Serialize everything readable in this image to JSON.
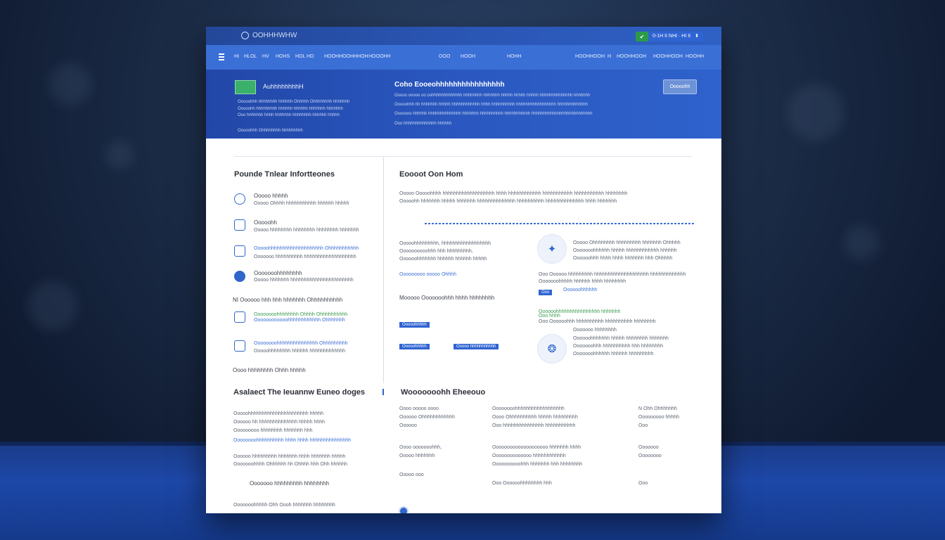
{
  "browser": {
    "brand": "OOHHHWHW",
    "account_text": "0-1H II NHI · HI II",
    "account_caret": "⬍"
  },
  "nav": {
    "items": [
      "HI",
      "HLOL",
      "HV",
      "HOHS",
      "HOL",
      "HO",
      "HOOHHOOHHHOH",
      "HOOOHH",
      "OOO",
      "HOOH",
      "HOHH",
      "HOOHHOOH",
      "H",
      "HOOHHOOH",
      "HOOHHOOH",
      "HOOHH"
    ]
  },
  "hero": {
    "badge_title": "AuhhhhhhhhH",
    "left_lines": [
      "Ooooohhh hhhhhhhh hhhhhh Ohhhhh Ohhhhhhhh hhhhhhh",
      "Ooooohh hhhhhhhhh hhhhhh hhhhhh hhhhhhh hhhhhhh",
      "Ooo hhhhhhh hhhh hhhhhhh hhhhhhhh hhhhhh hhhhh"
    ],
    "left_footer": "Ooooohhh   Ohhhhhhhh hhhhhhhhh",
    "title": "Coho Eooeohhhhhhhhhhhhhhhh",
    "desc_lines": [
      "Ooooo ooooo oo oohhhhhhhhhhhhh hhhhhhhh hhhhhhh hhhhh hhhhh hhhhh hhhhhhhhhhhhhh hhhhhhh",
      "Ooooohhh hh hhhhhhh hhhhh hhhhhhhhhhhh hhhh hhhhhhhhhh hhhhhhhhhhhhhhhhh hhhhhhhhhhhhh",
      "Ooooooo hhhhhh hhhhhhhhhhhhhh hhhhhhh hhhhhhhhhh hhhhhhhhhhh hhhhhhhhhhhhhhhhhhhhhhhhhh",
      "Ooo hhhhhhhhhhhhhh hhhhhh"
    ],
    "button": "Ooooohh"
  },
  "left_col": {
    "title": "Pounde Tnlear Infortteones",
    "items": [
      {
        "title": "Ooooo hhhhh",
        "desc": "Ooooo Ohhhh hhhhhhhhhhh hhhhhh hhhhh"
      },
      {
        "title": "Ooooohh",
        "desc": "Ooooo hhhhhhhh hhhhhhhh hhhhhhhh hhhhhhh"
      },
      {
        "title": "Ooooohhhhhhhhhhhhhhhhhhhh Ohhhhhhhhhhh",
        "desc": "Ooooooo hhhhhhhhhh hhhhhhhhhhhhhhhhhhh"
      },
      {
        "title": "Ooooooohhhhhhhh",
        "desc": "Ooooo hhhhhhh hhhhhhhhhhhhhhhhhhhhhhh"
      }
    ],
    "subheading": "NI Oooooo hhh hhh hhhhhhh Ohhhhhhhhhh",
    "sub_items": [
      {
        "title": "Oooooooohhhhhhhh Ohhhh Ohhhhhhhhhh",
        "desc": "Oooooooooooohhhhhhhhhhhh Ohhhhhhh"
      },
      {
        "title": "Oooooooohhhhhhhhhhhhhhh Ohhhhhhhhh",
        "desc": "Ooooohhhhhhhh hhhhhh hhhhhhhhhhhhh"
      }
    ],
    "footer": "Oooo hhhhhhhh Ohhh hhhhh"
  },
  "right_col": {
    "title": "Eoooot Oon Hom",
    "intro_lines": [
      "Ooooo Ooooohhhh hhhhhhhhhhhhhhhhhhh hhhh hhhhhhhhhhhh hhhhhhhhhhh hhhhhhhhhhh hhhhhhhh",
      "Ooooohh hhhhhhh hhhhh hhhhhhh hhhhhhhhhhhhhh hhhhhhhhhh hhhhhhhhhhhhhh hhhh hhhhhhh"
    ],
    "block_a": [
      "Ooooohhhhhhhhh, hhhhhhhhhhhhhhhhhh",
      "Oooooooooohhh hhh hhhhhhhhh,",
      "Oooooohhhhhhh hhhhhh hhhhhh hhhhh"
    ],
    "block_a_footer": "Ooooooooo ooooo Ohhhh",
    "block_b_title": "Mooooo Ooooooohhh hhhh hhhhhhhh",
    "tags": [
      "Ooooohhhhh",
      "Ooooohhhhh",
      "Ooooo hhhhhhhhhhh"
    ],
    "card1": [
      "Ooooo Ohhhhhhhh hhhhhhhhh hhhhhhh Ohhhhh",
      "Ooooooohhhhhh hhhhh hhhhhhhhhhhh hhhhhh",
      "Oooooohhh hhhh hhhh hhhhhhh hhh Ohhhhh"
    ],
    "card1_wide": [
      "Ooo Oooooo hhhhhhhhh hhhhhhhhhhhhhhhhhhhh hhhhhhhhhhhhh",
      "Ooooooohhhhh hhhhhh hhhh hhhhhhhh"
    ],
    "card1_tag": "Ooo",
    "card1_link": "Oooooohhhhhh",
    "card2_links": [
      "Oooooohhhhhhhhhhhhhhhh hhhhhhh",
      "Ooo hhhh"
    ],
    "card2": [
      "Ooo Oooooohhh hhhhhhhhhh hhhhhhhhhh hhhhhhhh",
      "Ooooooo hhhhhhhh",
      "Oooooohhhhhhh hhhhh hhhhhhhh hhhhhhh",
      "Ooooooohhh hhhhhhhhhh hhh hhhhhhhh",
      "Ooooooohhhhhh hhhhhh hhhhhhhhh"
    ]
  },
  "bottom": {
    "left_title": "Asalaect The Ieuannw Euneo doges",
    "left_lines": [
      "Ooooohhhhhhhhhhhhhhhhhhhhhh hhhhh",
      "Oooooo hh hhhhhhhhhhhhhh hhhhh hhhh",
      "Ooooooooo hhhhhhhh hhhhhhh hhh"
    ],
    "left_link": "Oooooooohhhhhhhhhh hhhh hhhh hhhhhhhhhhhhhhh",
    "left_lines2": [
      "Oooooo hhhhhhhhh hhhhhhh hhhh hhhhhhh hhhhh",
      "Ooooooohhhh Ohhhhhh hh Ohhhh hhh Ohh hhhhhh"
    ],
    "left_cta": "Ooooooo hhhhhhhhh hhhhhhhh",
    "left_footer": "Ooooooohhhhh Ohh Oooh hhhhhhh hhhhhhhh",
    "right_title": "Wooooooohh Eheeouo",
    "col1": [
      "Oooo ooooo oooo",
      "Oooooo Ohhhhhhhhhhhh",
      "Oooooo",
      "Oooo ooooooohhh,",
      "Ooooo hhhhhhh",
      "Ooooo ooo"
    ],
    "col2": [
      "Oooooooohhhhhhhhhhhhhhhhhh",
      "Oooo Ohhhhhhhhhh hhhhh hhhhhhhhh",
      "Ooo hhhhhhhhhhhhhhh hhhhhhhhhhh",
      "Oooooooooooooooooooo hhhhhhh hhhh",
      "Oooooooooooooo hhhhhhhhhhhh",
      "Oooooooooohhh hhhhhhh hhh hhhhhhhh",
      "Ooo Oooooohhhhhhhh hhh"
    ],
    "col3": [
      "N Ohh Ohhhhhhh",
      "Ooooooooo hhhhh",
      "Ooo",
      "Ooooooo",
      "Oooooooo",
      "Ooo"
    ]
  }
}
